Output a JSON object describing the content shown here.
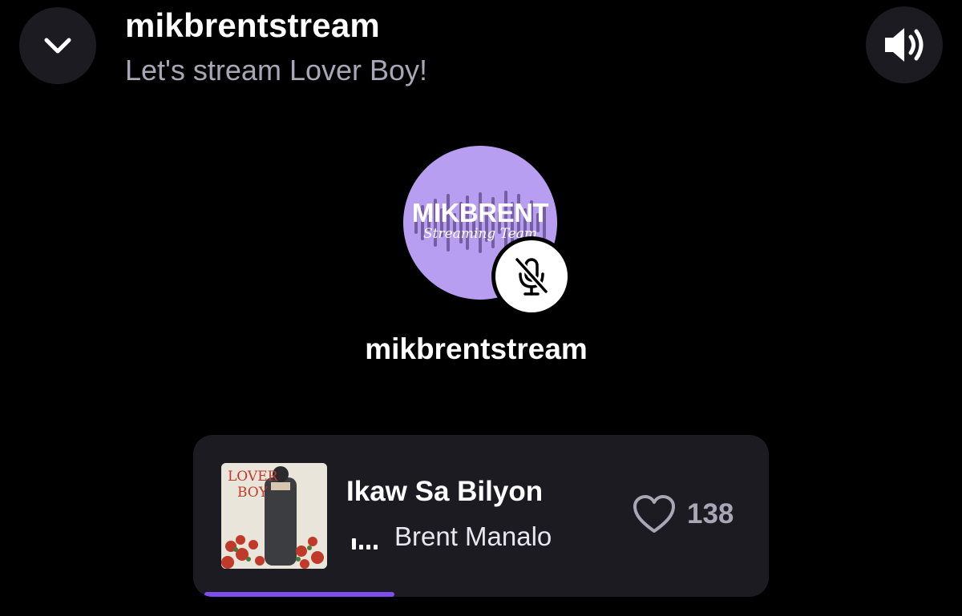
{
  "header": {
    "title": "mikbrentstream",
    "subtitle": "Let's stream Lover Boy!"
  },
  "icons": {
    "collapse": "chevron-down-icon",
    "sound": "speaker-icon",
    "mute": "microphone-muted-icon",
    "like": "heart-icon",
    "now_playing": "equalizer-bars-icon"
  },
  "host": {
    "name": "mikbrentstream",
    "avatar_logo_text": "MIKBRENT",
    "avatar_logo_subtext": "Streaming Team",
    "muted": true
  },
  "now_playing": {
    "album_cover_text_1": "LOVER",
    "album_cover_text_2": "BOY",
    "title": "Ikaw Sa Bilyon",
    "artist": "Brent Manalo",
    "likes": "138",
    "progress": 0.33
  },
  "colors": {
    "background": "#000000",
    "surface": "#1c1b22",
    "muted_text": "#a9a6b6",
    "avatar_bg": "#b79ef0",
    "accent": "#7d4dee"
  }
}
